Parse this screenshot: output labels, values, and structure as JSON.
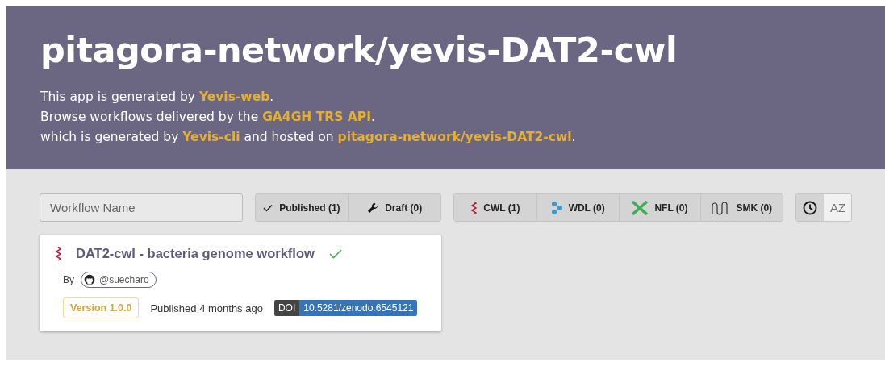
{
  "header": {
    "title": "pitagora-network/yevis-DAT2-cwl",
    "lines": [
      [
        {
          "text": "This app is generated by ",
          "link": false
        },
        {
          "text": "Yevis-web",
          "link": true
        },
        {
          "text": ".",
          "link": false
        }
      ],
      [
        {
          "text": "Browse workflows delivered by the ",
          "link": false
        },
        {
          "text": "GA4GH TRS API",
          "link": true
        },
        {
          "text": ".",
          "link": false
        }
      ],
      [
        {
          "text": "which is generated by ",
          "link": false
        },
        {
          "text": "Yevis-cli",
          "link": true
        },
        {
          "text": " and hosted on ",
          "link": false
        },
        {
          "text": "pitagora-network/yevis-DAT2-cwl",
          "link": true
        },
        {
          "text": ".",
          "link": false
        }
      ]
    ]
  },
  "search": {
    "placeholder": "Workflow Name"
  },
  "status_filters": [
    {
      "kind": "published",
      "label": "Published (1)",
      "selected": true
    },
    {
      "kind": "draft",
      "label": "Draft (0)",
      "selected": true
    }
  ],
  "type_filters": [
    {
      "kind": "cwl",
      "label": "CWL (1)",
      "selected": true
    },
    {
      "kind": "wdl",
      "label": "WDL (0)",
      "selected": true
    },
    {
      "kind": "nfl",
      "label": "NFL (0)",
      "selected": true
    },
    {
      "kind": "smk",
      "label": "SMK (0)",
      "selected": true
    }
  ],
  "sort": [
    {
      "kind": "time",
      "selected": true
    },
    {
      "kind": "alpha",
      "label": "AZ",
      "selected": false
    }
  ],
  "workflows": [
    {
      "kind": "cwl",
      "title": "DAT2-cwl - bacteria genome workflow",
      "verified": true,
      "by": "By",
      "author": "@suecharo",
      "version": "Version 1.0.0",
      "published": "Published 4 months ago",
      "doi_label": "DOI",
      "doi": "10.5281/zenodo.6545121"
    }
  ]
}
